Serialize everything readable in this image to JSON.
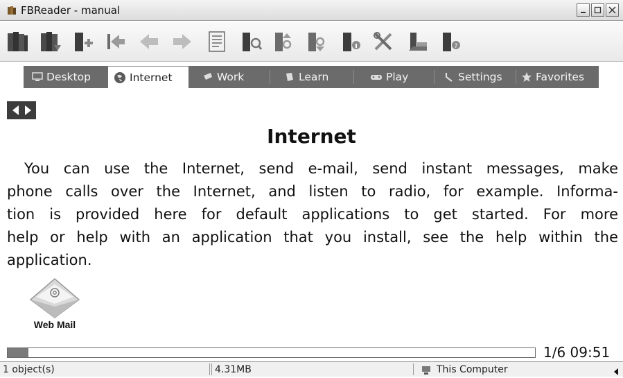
{
  "window": {
    "title": "FBReader - manual"
  },
  "toolbar": {
    "buttons": [
      {
        "icon": "library-icon"
      },
      {
        "icon": "book-network-library-icon"
      },
      {
        "icon": "add-book-icon"
      },
      {
        "icon": "go-to-start-icon"
      },
      {
        "icon": "back-arrow-icon"
      },
      {
        "icon": "forward-arrow-icon"
      },
      {
        "icon": "table-of-contents-icon"
      },
      {
        "icon": "search-book-icon"
      },
      {
        "icon": "find-previous-icon"
      },
      {
        "icon": "find-next-icon"
      },
      {
        "icon": "book-info-icon"
      },
      {
        "icon": "preferences-tools-icon"
      },
      {
        "icon": "rotate-screen-icon"
      },
      {
        "icon": "about-icon"
      }
    ]
  },
  "tabs": [
    {
      "label": "Desktop",
      "icon": "desktop-icon"
    },
    {
      "label": "Internet",
      "icon": "globe-icon",
      "active": true
    },
    {
      "label": "Work",
      "icon": "work-icon"
    },
    {
      "label": "Learn",
      "icon": "learn-icon"
    },
    {
      "label": "Play",
      "icon": "play-icon"
    },
    {
      "label": "Settings",
      "icon": "wrench-icon"
    },
    {
      "label": "Favorites",
      "icon": "star-icon"
    }
  ],
  "content": {
    "heading": "Internet",
    "lines": [
      "You can use the Internet, send e-mail, send instant messages, make",
      "phone calls over the Internet, and listen to radio, for example. Informa-",
      "tion is provided here for default applications to get started. For more",
      "help or help with an application that you install, see the help within the",
      "application."
    ],
    "webmail_label": "Web Mail"
  },
  "progress": {
    "fraction": 0.04,
    "page": "1/6",
    "time": "09:51"
  },
  "status": {
    "objects": "1 object(s)",
    "size": "4.31MB",
    "location": "This Computer"
  }
}
